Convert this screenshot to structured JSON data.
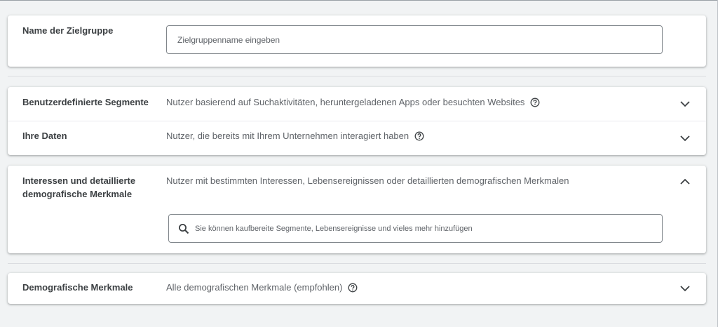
{
  "audience_name": {
    "label": "Name der Zielgruppe",
    "placeholder": "Zielgruppenname eingeben"
  },
  "sections": [
    {
      "label": "Benutzerdefinierte Segmente",
      "description": "Nutzer basierend auf Suchaktivitäten, heruntergeladenen Apps oder besuchten Websites",
      "help_icon": "help-circle-icon",
      "chevron_icon": "chevron-down-icon",
      "expanded": false
    },
    {
      "label": "Ihre Daten",
      "description": "Nutzer, die bereits mit Ihrem Unternehmen interagiert haben",
      "help_icon": "help-circle-icon",
      "chevron_icon": "chevron-down-icon",
      "expanded": false
    },
    {
      "label_line1": "Interessen und detaillierte",
      "label_line2": "demografische Merkmale",
      "description": "Nutzer mit bestimmten Interessen, Lebensereignissen oder detaillierten demografischen Merkmalen",
      "chevron_icon": "chevron-up-icon",
      "expanded": true,
      "search": {
        "icon": "search-icon",
        "placeholder": "Sie können kaufbereite Segmente, Lebensereignisse und vieles mehr hinzufügen"
      }
    },
    {
      "label": "Demografische Merkmale",
      "description": "Alle demografischen Merkmale (empfohlen)",
      "help_icon": "help-circle-icon",
      "chevron_icon": "chevron-down-icon",
      "expanded": false
    }
  ],
  "colors": {
    "background": "#f1f3f4",
    "card": "#ffffff",
    "text": "#3c4043",
    "secondary_text": "#5f6368"
  }
}
